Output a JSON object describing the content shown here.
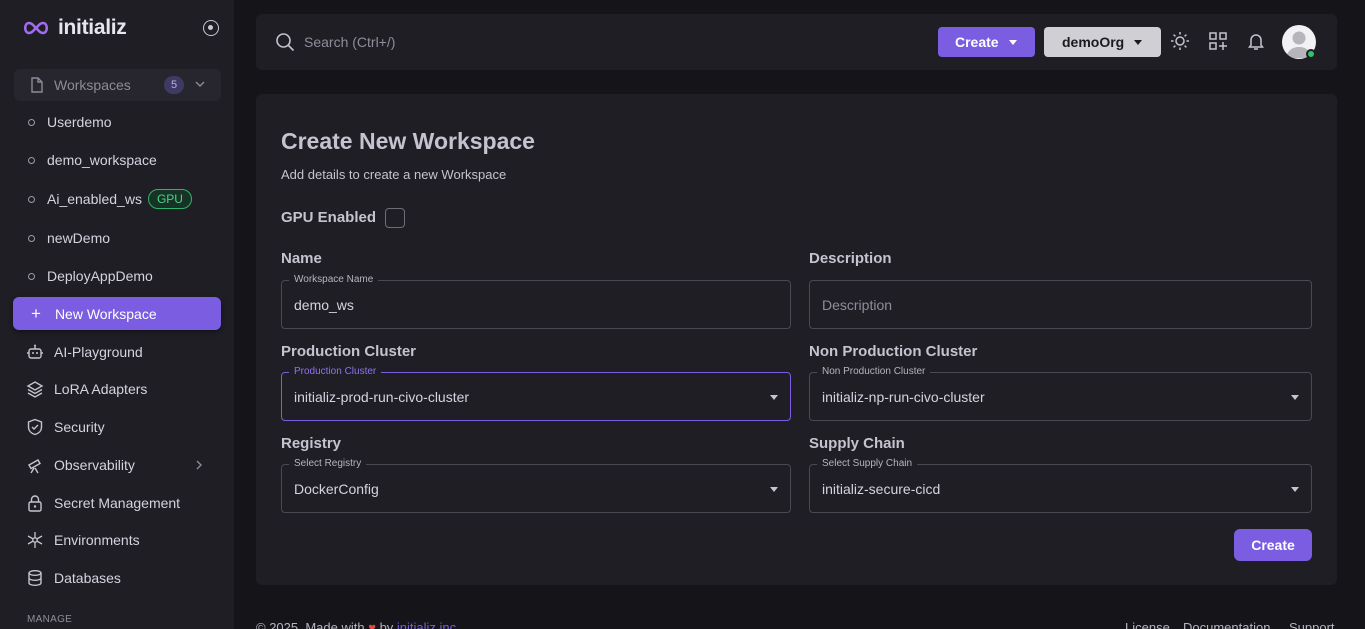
{
  "brand": {
    "name": "initializ"
  },
  "sidebar": {
    "workspaces_label": "Workspaces",
    "workspaces_count": "5",
    "workspace_items": [
      {
        "label": "Userdemo"
      },
      {
        "label": "demo_workspace"
      },
      {
        "label": "Ai_enabled_ws",
        "tag": "GPU"
      },
      {
        "label": "newDemo"
      },
      {
        "label": "DeployAppDemo"
      }
    ],
    "new_workspace": "New Workspace",
    "nav_items": [
      {
        "label": "AI-Playground",
        "icon": "robot-icon"
      },
      {
        "label": "LoRA Adapters",
        "icon": "layers-icon"
      },
      {
        "label": "Security",
        "icon": "shield-icon"
      },
      {
        "label": "Observability",
        "icon": "telescope-icon"
      },
      {
        "label": "Secret Management",
        "icon": "lock-icon"
      },
      {
        "label": "Environments",
        "icon": "snowflake-icon"
      },
      {
        "label": "Databases",
        "icon": "database-icon"
      }
    ],
    "manage_label": "MANAGE"
  },
  "topbar": {
    "search_placeholder": "Search (Ctrl+/)",
    "create_label": "Create",
    "org_label": "demoOrg"
  },
  "form": {
    "title": "Create New Workspace",
    "subtitle": "Add details to create a new Workspace",
    "gpu_label": "GPU Enabled",
    "gpu_checked": false,
    "name_heading": "Name",
    "name_legend": "Workspace Name",
    "name_value": "demo_ws",
    "description_heading": "Description",
    "description_placeholder": "Description",
    "prod_heading": "Production Cluster",
    "prod_legend": "Production Cluster",
    "prod_value": "initializ-prod-run-civo-cluster",
    "nonprod_heading": "Non Production Cluster",
    "nonprod_legend": "Non Production Cluster",
    "nonprod_value": "initializ-np-run-civo-cluster",
    "registry_heading": "Registry",
    "registry_legend": "Select Registry",
    "registry_value": "DockerConfig",
    "supply_heading": "Supply Chain",
    "supply_legend": "Select Supply Chain",
    "supply_value": "initializ-secure-cicd",
    "create_label": "Create"
  },
  "footer": {
    "copyright": "© 2025, Made with",
    "by": "by",
    "company": "initializ.inc",
    "links": [
      "License",
      "Documentation",
      "Support"
    ]
  },
  "colors": {
    "accent": "#7a5de0",
    "sidebar_bg": "#1f1e25",
    "page_bg": "#151419",
    "gpu_green": "#2fb36b"
  }
}
